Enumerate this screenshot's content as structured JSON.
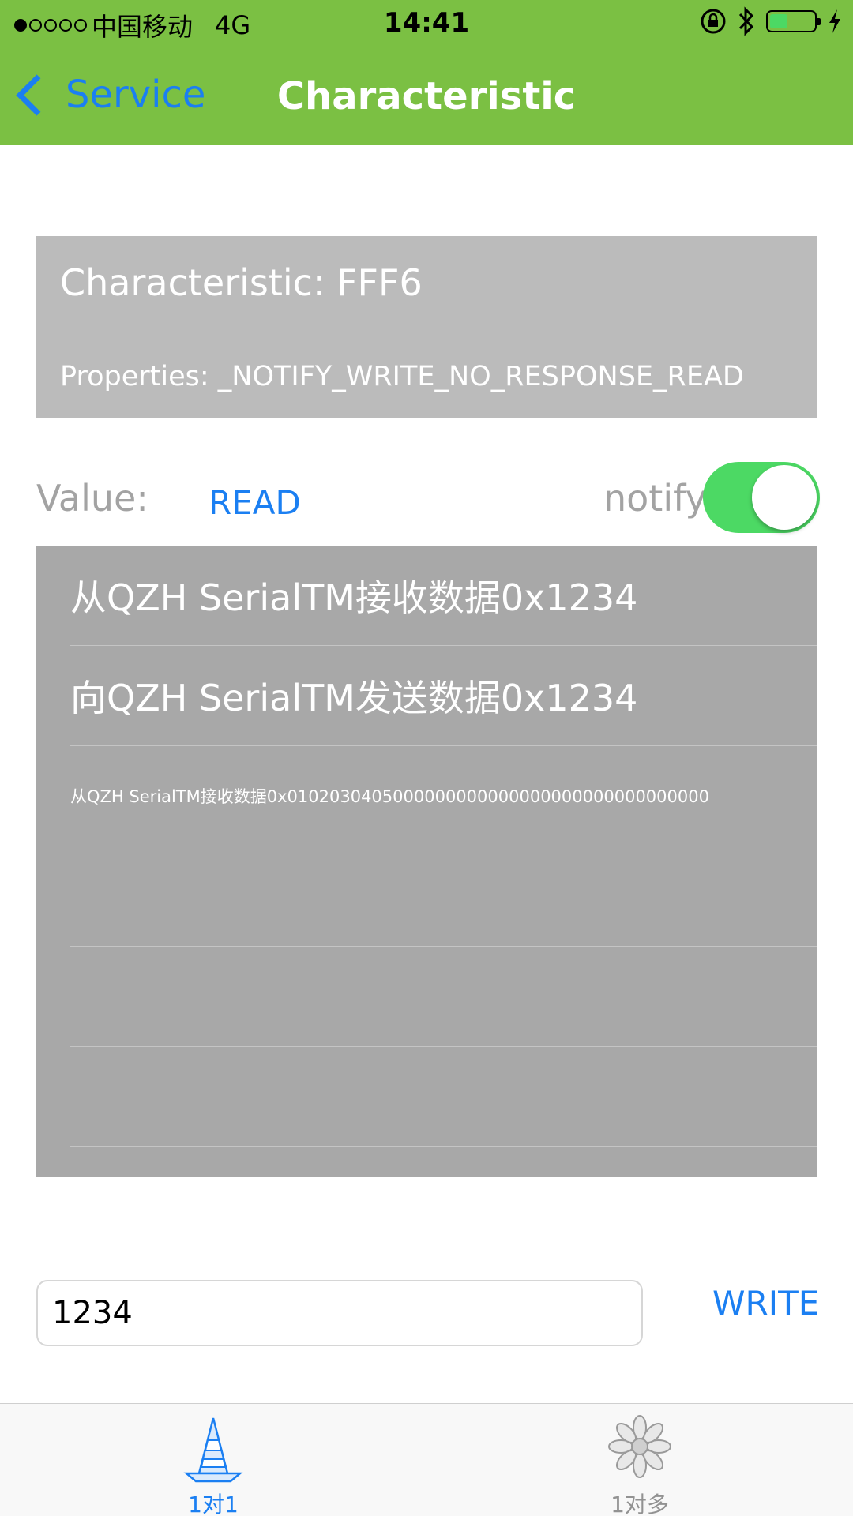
{
  "colors": {
    "brand": "#7bc043",
    "link": "#1b7ff2",
    "toggle_on": "#4cd964"
  },
  "status_bar": {
    "carrier": "中国移动",
    "network": "4G",
    "time": "14:41",
    "signal_dots_filled": 1,
    "signal_dots_total": 5,
    "icons": [
      "orientation-lock-icon",
      "bluetooth-icon",
      "battery-icon",
      "charging-icon"
    ]
  },
  "nav": {
    "back_label": "Service",
    "title": "Characteristic"
  },
  "characteristic": {
    "title": "Characteristic: FFF6",
    "properties": "Properties: _NOTIFY_WRITE_NO_RESPONSE_READ"
  },
  "value_row": {
    "label": "Value:",
    "read_button": "READ",
    "notify_label": "notify",
    "notify_on": true
  },
  "log": [
    {
      "text": "从QZH SerialTM接收数据0x1234"
    },
    {
      "text": "向QZH SerialTM发送数据0x1234"
    },
    {
      "text": "从QZH SerialTM接收数据0x0102030405000000000000000000000000000000"
    },
    {
      "text": ""
    },
    {
      "text": ""
    },
    {
      "text": ""
    }
  ],
  "write": {
    "input_value": "1234",
    "button": "WRITE"
  },
  "tabs": [
    {
      "label": "1对1",
      "icon": "traffic-cone-icon",
      "active": true
    },
    {
      "label": "1对多",
      "icon": "flower-icon",
      "active": false
    }
  ]
}
